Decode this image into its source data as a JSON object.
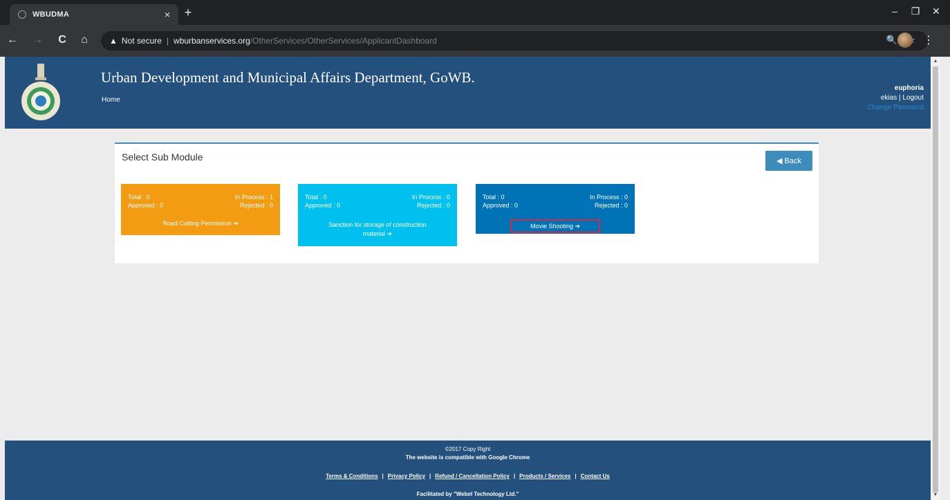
{
  "browser": {
    "tab_title": "WBUDMA",
    "tab_close": "×",
    "new_tab": "+",
    "back": "←",
    "forward": "→",
    "reload": "C",
    "home": "⌂",
    "warning_icon": "▲",
    "security_label": "Not secure",
    "separator": "|",
    "url_host": "wburbanservices.org",
    "url_path": "/OtherServices/OtherServices/ApplicantDashboard",
    "zoom_icon": "🔍",
    "star_icon": "☆",
    "menu_icon": "⋮",
    "minimize": "–",
    "maximize": "❐",
    "close": "✕"
  },
  "header": {
    "title": "Urban Development and Municipal Affairs Department, GoWB.",
    "home_link": "Home",
    "user_name": "euphoria",
    "user_links_left": "ekias",
    "user_links_sep": " | ",
    "user_links_right": "Logout",
    "change_password": "Change Password"
  },
  "panel": {
    "title": "Select Sub Module",
    "back_label": "◀ Back"
  },
  "cards": [
    {
      "total_label": "Total : 0",
      "in_process_label": "In Process : 1",
      "approved_label": "Approved : 0",
      "rejected_label": "Rejected : 0",
      "link_label": "Road Cutting Permission ➔",
      "color": "#f39c12"
    },
    {
      "total_label": "Total : 0",
      "in_process_label": "In Process : 0",
      "approved_label": "Approved : 0",
      "rejected_label": "Rejected : 0",
      "link_label": "Sanction for storage of construction material ➔",
      "color": "#00c0ef"
    },
    {
      "total_label": "Total : 0",
      "in_process_label": "In Process : 0",
      "approved_label": "Approved : 0",
      "rejected_label": "Rejected : 0",
      "link_label": "Movie Shooting ➔",
      "color": "#0073b7"
    }
  ],
  "footer": {
    "copyright": "©2017 Copy Right",
    "compat": "The website is compatible with Google Chrome",
    "links": [
      "Terms & Conditions",
      "Privacy Policy",
      "Refund / Cancellation Policy",
      "Products / Services",
      "Contact Us"
    ],
    "link_sep": "|",
    "facilitated": "Facilitated by \"Webel Technology Ltd.\""
  },
  "scrollbar": {
    "up": "▲",
    "down": "▼"
  }
}
